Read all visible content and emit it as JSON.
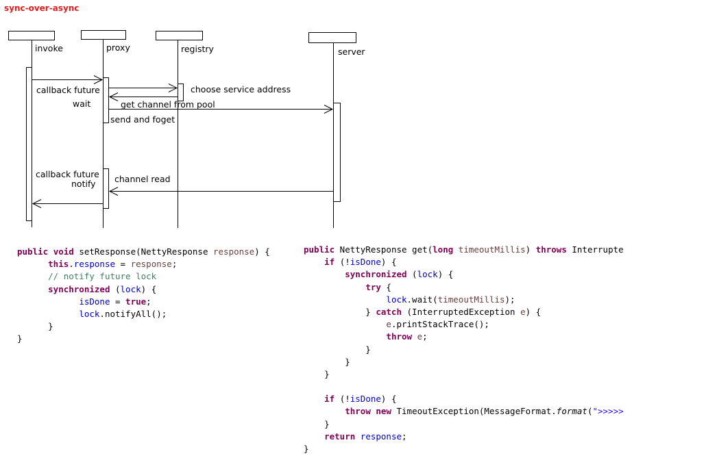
{
  "title": "sync-over-async",
  "diagram": {
    "participants": [
      "invoke",
      "proxy",
      "registry",
      "server"
    ],
    "labels": {
      "callback_future_1": "callback future",
      "wait": "wait",
      "choose_service_address": "choose service address",
      "get_channel_from_pool": "get channel from pool",
      "send_and_foget": "send and foget",
      "callback_future_2": "callback future",
      "notify": "notify",
      "channel_read": "channel read"
    }
  },
  "code_left": [
    [
      [
        "kw",
        "public"
      ],
      [
        "t",
        " "
      ],
      [
        "kw",
        "void"
      ],
      [
        "t",
        " setResponse(NettyResponse "
      ],
      [
        "par",
        "response"
      ],
      [
        "t",
        ") {"
      ]
    ],
    [
      [
        "t",
        "      "
      ],
      [
        "kw",
        "this"
      ],
      [
        "t",
        "."
      ],
      [
        "fld",
        "response"
      ],
      [
        "t",
        " = "
      ],
      [
        "par",
        "response"
      ],
      [
        "t",
        ";"
      ]
    ],
    [
      [
        "t",
        "      "
      ],
      [
        "cmt",
        "// notify future lock"
      ]
    ],
    [
      [
        "t",
        "      "
      ],
      [
        "kw",
        "synchronized"
      ],
      [
        "t",
        " ("
      ],
      [
        "fld",
        "lock"
      ],
      [
        "t",
        ") {"
      ]
    ],
    [
      [
        "t",
        "            "
      ],
      [
        "fld",
        "isDone"
      ],
      [
        "t",
        " = "
      ],
      [
        "kw",
        "true"
      ],
      [
        "t",
        ";"
      ]
    ],
    [
      [
        "t",
        "            "
      ],
      [
        "fld",
        "lock"
      ],
      [
        "t",
        ".notifyAll();"
      ]
    ],
    [
      [
        "t",
        "      }"
      ]
    ],
    [
      [
        "t",
        "}"
      ]
    ]
  ],
  "code_right": [
    [
      [
        "kw",
        "public"
      ],
      [
        "t",
        " NettyResponse get("
      ],
      [
        "kw",
        "long"
      ],
      [
        "t",
        " "
      ],
      [
        "par",
        "timeoutMillis"
      ],
      [
        "t",
        ") "
      ],
      [
        "kw",
        "throws"
      ],
      [
        "t",
        " Interrupte"
      ]
    ],
    [
      [
        "t",
        "    "
      ],
      [
        "kw",
        "if"
      ],
      [
        "t",
        " (!"
      ],
      [
        "fld",
        "isDone"
      ],
      [
        "t",
        ") {"
      ]
    ],
    [
      [
        "t",
        "        "
      ],
      [
        "kw",
        "synchronized"
      ],
      [
        "t",
        " ("
      ],
      [
        "fld",
        "lock"
      ],
      [
        "t",
        ") {"
      ]
    ],
    [
      [
        "t",
        "            "
      ],
      [
        "kw",
        "try"
      ],
      [
        "t",
        " {"
      ]
    ],
    [
      [
        "t",
        "                "
      ],
      [
        "fld",
        "lock"
      ],
      [
        "t",
        ".wait("
      ],
      [
        "par",
        "timeoutMillis"
      ],
      [
        "t",
        ");"
      ]
    ],
    [
      [
        "t",
        "            } "
      ],
      [
        "kw",
        "catch"
      ],
      [
        "t",
        " (InterruptedException "
      ],
      [
        "par",
        "e"
      ],
      [
        "t",
        ") {"
      ]
    ],
    [
      [
        "t",
        "                "
      ],
      [
        "par",
        "e"
      ],
      [
        "t",
        ".printStackTrace();"
      ]
    ],
    [
      [
        "t",
        "                "
      ],
      [
        "kw",
        "throw"
      ],
      [
        "t",
        " "
      ],
      [
        "par",
        "e"
      ],
      [
        "t",
        ";"
      ]
    ],
    [
      [
        "t",
        "            }"
      ]
    ],
    [
      [
        "t",
        "        }"
      ]
    ],
    [
      [
        "t",
        "    }"
      ]
    ],
    [
      [
        "t",
        ""
      ]
    ],
    [
      [
        "t",
        "    "
      ],
      [
        "kw",
        "if"
      ],
      [
        "t",
        " (!"
      ],
      [
        "fld",
        "isDone"
      ],
      [
        "t",
        ") {"
      ]
    ],
    [
      [
        "t",
        "        "
      ],
      [
        "kw",
        "throw"
      ],
      [
        "t",
        " "
      ],
      [
        "kw",
        "new"
      ],
      [
        "t",
        " TimeoutException(MessageFormat."
      ],
      [
        "st",
        "format"
      ],
      [
        "t",
        "("
      ],
      [
        "str",
        "\">>>>>"
      ]
    ],
    [
      [
        "t",
        "    }"
      ]
    ],
    [
      [
        "t",
        "    "
      ],
      [
        "kw",
        "return"
      ],
      [
        "t",
        " "
      ],
      [
        "fld",
        "response"
      ],
      [
        "t",
        ";"
      ]
    ],
    [
      [
        "t",
        "}"
      ]
    ]
  ]
}
